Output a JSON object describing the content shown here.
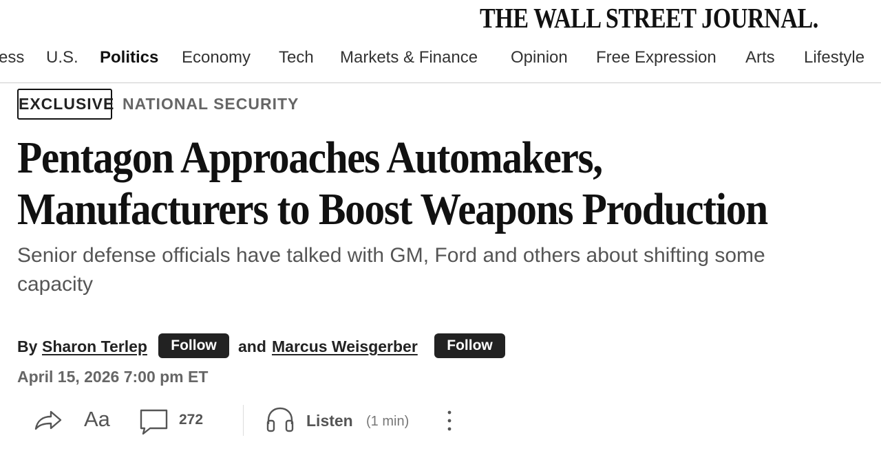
{
  "masthead": {
    "title": "THE WALL STREET JOURNAL."
  },
  "nav": {
    "items": [
      {
        "label": "Business",
        "visible_text": "ess",
        "active": false
      },
      {
        "label": "U.S.",
        "active": false
      },
      {
        "label": "Politics",
        "active": true
      },
      {
        "label": "Economy",
        "active": false
      },
      {
        "label": "Tech",
        "active": false
      },
      {
        "label": "Markets & Finance",
        "active": false
      },
      {
        "label": "Opinion",
        "active": false
      },
      {
        "label": "Free Expression",
        "active": false
      },
      {
        "label": "Arts",
        "active": false
      },
      {
        "label": "Lifestyle",
        "active": false
      }
    ]
  },
  "article": {
    "flag": "EXCLUSIVE",
    "section": "NATIONAL SECURITY",
    "headline_line1": "Pentagon Approaches Automakers,",
    "headline_line2": "Manufacturers to Boost Weapons Production",
    "dek": "Senior defense officials have talked with GM, Ford and others about shifting some capacity",
    "byline": {
      "by": "By",
      "and": "and",
      "authors": [
        {
          "name": "Sharon Terlep",
          "follow_label": "Follow"
        },
        {
          "name": "Marcus Weisgerber",
          "follow_label": "Follow"
        }
      ]
    },
    "timestamp": "April 15, 2026 7:00 pm ET"
  },
  "toolbar": {
    "share_icon": "share-arrow-icon",
    "text_size_label": "Aa",
    "comment_icon": "comment-bubble-icon",
    "comment_count": "272",
    "listen_icon": "headphones-icon",
    "listen_label": "Listen",
    "listen_duration": "(1 min)",
    "more_icon": "more-vertical-icon"
  },
  "colors": {
    "text_primary": "#111111",
    "text_secondary": "#555555",
    "text_muted": "#666666",
    "button_bg": "#222222",
    "divider": "#cccccc"
  }
}
